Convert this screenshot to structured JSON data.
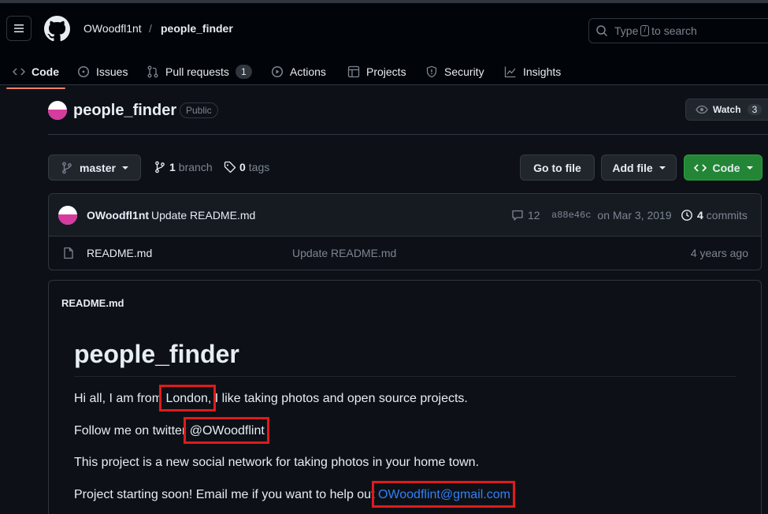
{
  "header": {
    "owner": "OWoodfl1nt",
    "separator": "/",
    "repo": "people_finder",
    "search_placeholder_pre": "Type",
    "search_key": "/",
    "search_placeholder_post": "to search"
  },
  "tabs": [
    {
      "label": "Code",
      "icon": "code-icon",
      "active": true
    },
    {
      "label": "Issues",
      "icon": "issue-icon"
    },
    {
      "label": "Pull requests",
      "icon": "pull-request-icon",
      "count": "1"
    },
    {
      "label": "Actions",
      "icon": "play-icon"
    },
    {
      "label": "Projects",
      "icon": "table-icon"
    },
    {
      "label": "Security",
      "icon": "shield-icon"
    },
    {
      "label": "Insights",
      "icon": "graph-icon"
    }
  ],
  "repo": {
    "name": "people_finder",
    "visibility": "Public",
    "watch_label": "Watch",
    "watch_count": "3"
  },
  "toolbar": {
    "branch": "master",
    "branch_count": "1",
    "branch_word": "branch",
    "tag_count": "0",
    "tag_word": "tags",
    "goto_file": "Go to file",
    "add_file": "Add file",
    "code": "Code"
  },
  "commit": {
    "author": "OWoodfl1nt",
    "message": "Update README.md",
    "comments": "12",
    "sha": "a88e46c",
    "date": "on Mar 3, 2019",
    "commits_count": "4",
    "commits_word": "commits"
  },
  "files": [
    {
      "name": "README.md",
      "message": "Update README.md",
      "age": "4 years ago"
    }
  ],
  "readme": {
    "label": "README.md",
    "heading": "people_finder",
    "p1_pre": "Hi all, I am from",
    "p1_city": "London,",
    "p1_post": "I like taking photos and open source projects.",
    "p2_pre": "Follow me on twitter",
    "p2_handle": "@OWoodflint",
    "p3": "This project is a new social network for taking photos in your home town.",
    "p4_pre": "Project starting soon! Email me if you want to help out",
    "p4_email": "OWoodflint@gmail.com"
  },
  "colors": {
    "background": "#0d1117",
    "accent_tab": "#f78166",
    "link": "#2f81f7",
    "highlight_box": "#e01b1b",
    "green_button": "#238636"
  }
}
